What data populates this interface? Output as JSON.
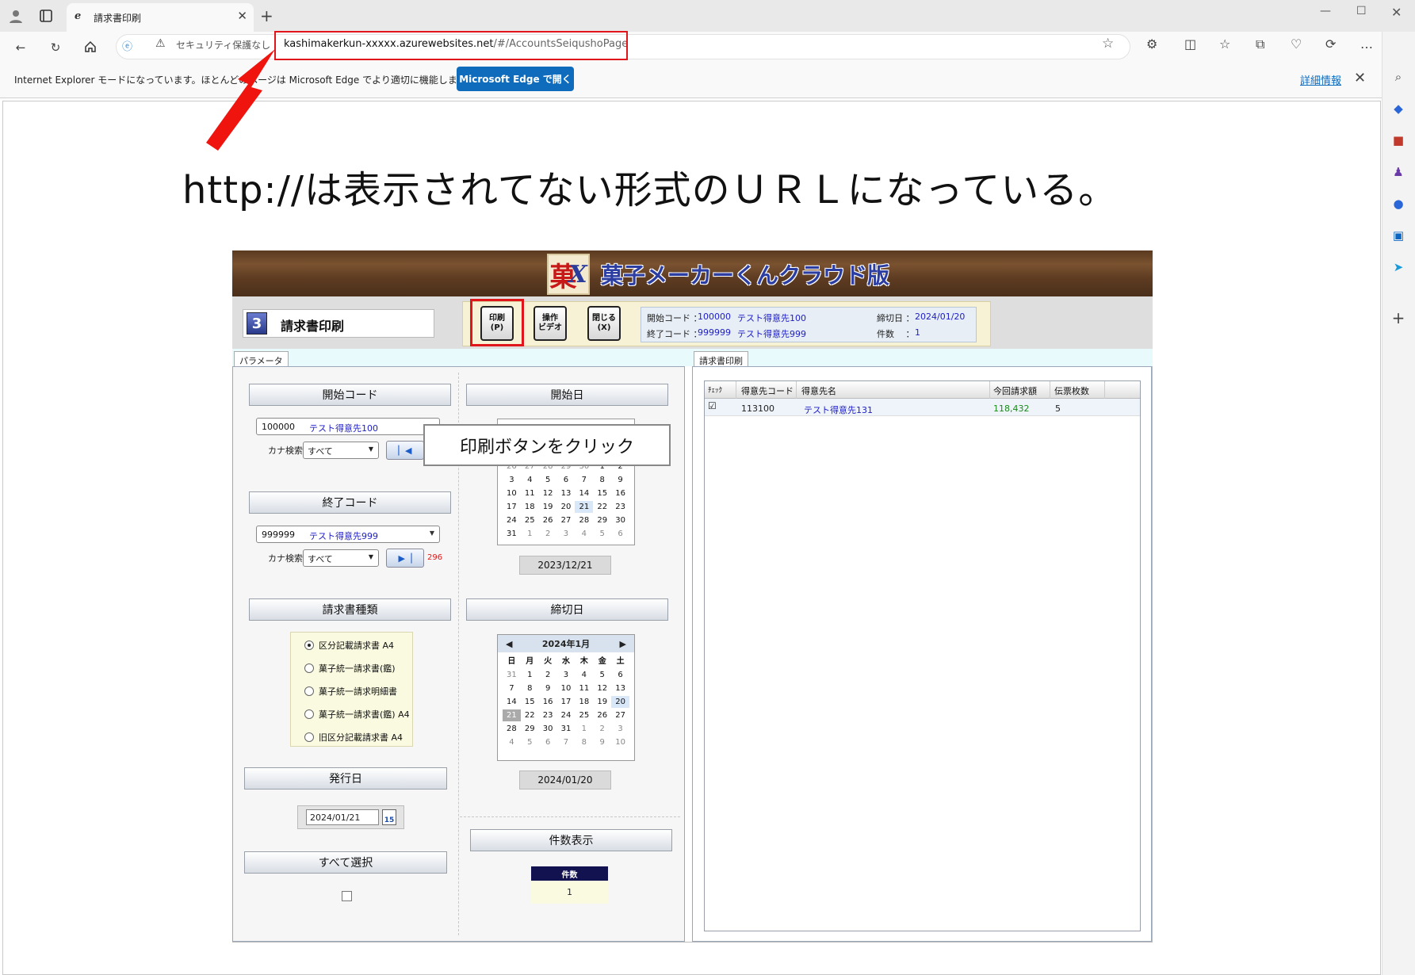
{
  "browser": {
    "tab_title": "請求書印刷",
    "security_label": "セキュリティ保護なし",
    "url_host": "kashimakerkun-xxxxx.azurewebsites.net",
    "url_path": "/#/AccountsSeiqushoPage",
    "ie_bar_text": "Internet Explorer モードになっています。ほとんどのページは Microsoft Edge でより適切に機能します。",
    "ie_bar_button": "Microsoft Edge で開く",
    "ie_bar_more": "詳細情報"
  },
  "annotation": {
    "caption": "http://は表示されてない形式のＵＲＬになっている。",
    "callout": "印刷ボタンをクリック",
    "accent_color": "#e0161b"
  },
  "app": {
    "title": "菓子メーカーくんクラウド版",
    "screen_number": "3",
    "screen_title": "請求書印刷",
    "buttons": {
      "print": {
        "line1": "印刷",
        "line2": "(P)"
      },
      "video": {
        "line1": "操作",
        "line2": "ビデオ"
      },
      "close": {
        "line1": "閉じる",
        "line2": "(X)"
      }
    },
    "info": {
      "start_code_label": "開始コード ：",
      "start_code": "100000",
      "start_name": "テスト得意先100",
      "end_code_label": "終了コード ：",
      "end_code": "999999",
      "end_name": "テスト得意先999",
      "cutoff_label": "締切日 ：",
      "cutoff_date": "2024/01/20",
      "count_label": "件数 　：",
      "count": "1"
    },
    "left_tab": "パラメータ",
    "right_tab": "請求書印刷",
    "start_code_head": "開始コード",
    "start_combo": {
      "code": "100000",
      "name": "テスト得意先100"
    },
    "kana_label": "カナ検索",
    "kana_value": "すべて",
    "end_code_head": "終了コード",
    "end_combo": {
      "code": "999999",
      "name": "テスト得意先999"
    },
    "end_count": "296",
    "start_date_head": "開始日",
    "start_date_value": "2023/12/21",
    "kind_head": "請求書種類",
    "kinds": [
      "区分記載請求書 A4",
      "菓子統一請求書(鑑)",
      "菓子統一請求明細書",
      "菓子統一請求書(鑑) A4",
      "旧区分記載請求書 A4"
    ],
    "cutoff_head": "締切日",
    "cutoff_value": "2024/01/20",
    "calendar_month": "2024年1月",
    "calendar_dow": [
      "日",
      "月",
      "火",
      "水",
      "木",
      "金",
      "土"
    ],
    "calendar_days": [
      "31",
      "1",
      "2",
      "3",
      "4",
      "5",
      "6",
      "7",
      "8",
      "9",
      "10",
      "11",
      "12",
      "13",
      "14",
      "15",
      "16",
      "17",
      "18",
      "19",
      "20",
      "21",
      "22",
      "23",
      "24",
      "25",
      "26",
      "27",
      "28",
      "29",
      "30",
      "31",
      "1",
      "2",
      "3",
      "4",
      "5",
      "6",
      "7",
      "8",
      "9",
      "10"
    ],
    "partial_cal_rows": [
      [
        "26",
        "27",
        "28",
        "29",
        "30",
        "1",
        "2"
      ],
      [
        "3",
        "4",
        "5",
        "6",
        "7",
        "8",
        "9"
      ],
      [
        "10",
        "11",
        "12",
        "13",
        "14",
        "15",
        "16"
      ],
      [
        "17",
        "18",
        "19",
        "20",
        "21",
        "22",
        "23"
      ],
      [
        "24",
        "25",
        "26",
        "27",
        "28",
        "29",
        "30"
      ],
      [
        "31",
        "1",
        "2",
        "3",
        "4",
        "5",
        "6"
      ]
    ],
    "issue_head": "発行日",
    "issue_date": "2024/01/21",
    "issue_cal_icon_text": "15",
    "select_all_head": "すべて選択",
    "count_head": "件数表示",
    "count_col": "件数",
    "count_val": "1",
    "grid": {
      "headers": [
        "ﾁｪｯｸ",
        "得意先コード",
        "得意先名",
        "今回請求額",
        "伝票枚数"
      ],
      "row": {
        "code": "113100",
        "name": "テスト得意先131",
        "amount": "118,432",
        "slips": "5"
      }
    }
  }
}
